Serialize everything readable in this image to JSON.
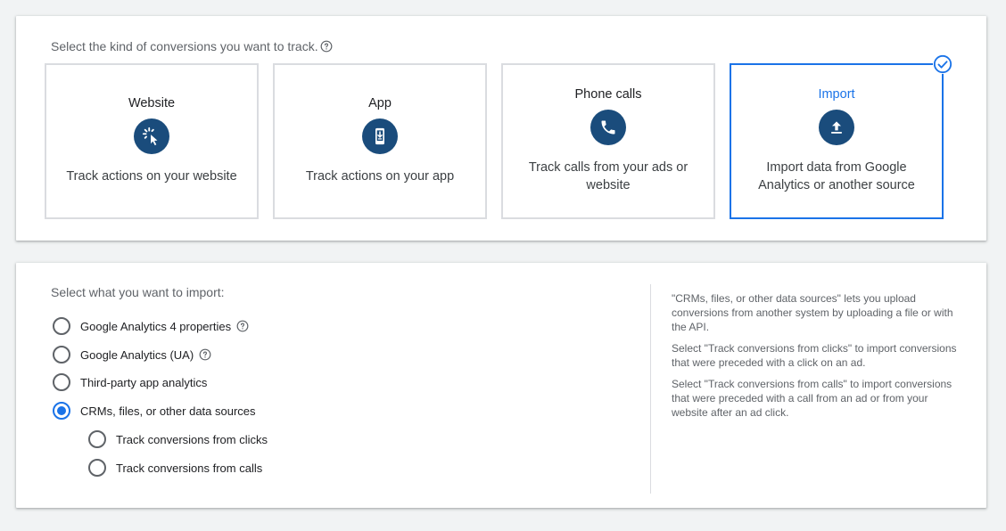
{
  "top_panel": {
    "heading": "Select the kind of conversions you want to track.",
    "cards": [
      {
        "title": "Website",
        "description": "Track actions on your website",
        "icon": "cursor-click-icon"
      },
      {
        "title": "App",
        "description": "Track actions on your app",
        "icon": "phone-download-icon"
      },
      {
        "title": "Phone calls",
        "description": "Track calls from your ads or website",
        "icon": "phone-icon"
      },
      {
        "title": "Import",
        "description": "Import data from Google Analytics or another source",
        "icon": "upload-icon",
        "selected": true
      }
    ]
  },
  "bottom_panel": {
    "heading": "Select what you want to import:",
    "options": [
      {
        "label": "Google Analytics 4 properties",
        "checked": false,
        "help": true
      },
      {
        "label": "Google Analytics (UA)",
        "checked": false,
        "help": true
      },
      {
        "label": "Third-party app analytics",
        "checked": false
      },
      {
        "label": "CRMs, files, or other data sources",
        "checked": true
      },
      {
        "label": "Track conversions from clicks",
        "checked": false,
        "sub": true
      },
      {
        "label": "Track conversions from calls",
        "checked": false,
        "sub": true
      }
    ],
    "info": [
      "\"CRMs, files, or other data sources\" lets you upload conversions from another system by uploading a file or with the API.",
      "Select \"Track conversions from clicks\" to import conversions that were preceded with a click on an ad.",
      "Select \"Track conversions from calls\" to import conversions that were preceded with a call from an ad or from your website after an ad click."
    ]
  },
  "colors": {
    "accent": "#1a73e8",
    "icon_bg": "#1a4c7c",
    "border": "#dadce0"
  }
}
